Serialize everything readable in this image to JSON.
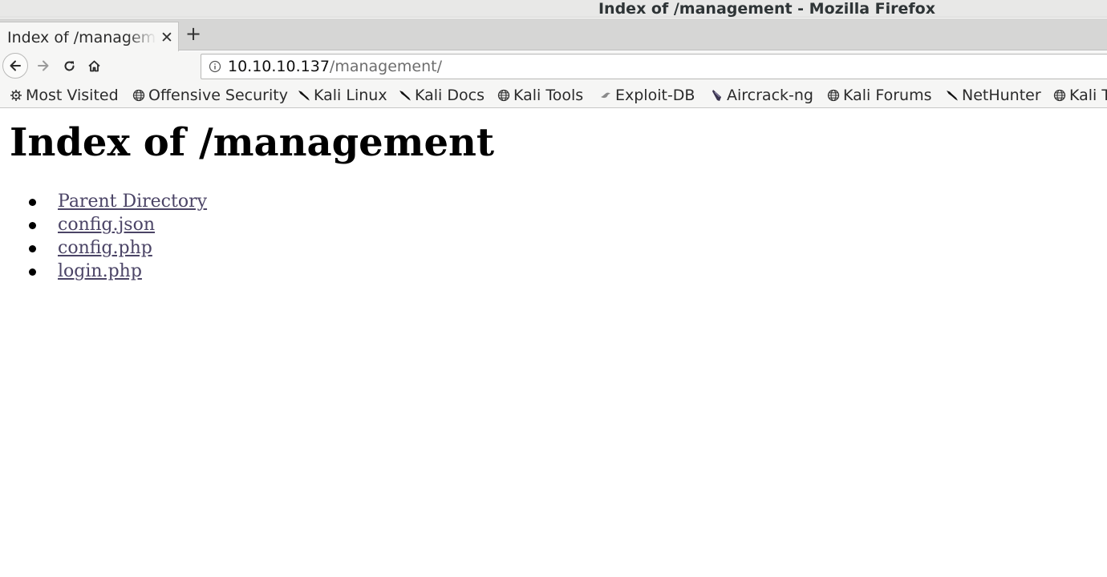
{
  "window": {
    "title": "Index of /management - Mozilla Firefox"
  },
  "tabs": [
    {
      "label": "Index of /management",
      "close_symbol": "✕"
    }
  ],
  "new_tab_symbol": "+",
  "urlbar": {
    "host": "10.10.10.137",
    "path": "/management/"
  },
  "bookmarks": [
    {
      "label": "Most Visited",
      "icon": "gear-icon"
    },
    {
      "label": "Offensive Security",
      "icon": "globe-icon"
    },
    {
      "label": "Kali Linux",
      "icon": "kali-dragon-icon"
    },
    {
      "label": "Kali Docs",
      "icon": "kali-dragon-icon"
    },
    {
      "label": "Kali Tools",
      "icon": "globe-icon"
    },
    {
      "label": "Exploit-DB",
      "icon": "exploit-db-icon"
    },
    {
      "label": "Aircrack-ng",
      "icon": "aircrack-icon"
    },
    {
      "label": "Kali Forums",
      "icon": "globe-icon"
    },
    {
      "label": "NetHunter",
      "icon": "kali-dragon-icon"
    },
    {
      "label": "Kali Training",
      "icon": "globe-icon"
    }
  ],
  "page": {
    "heading": "Index of /management",
    "entries": [
      {
        "label": "Parent Directory"
      },
      {
        "label": "config.json"
      },
      {
        "label": "config.php"
      },
      {
        "label": "login.php"
      }
    ]
  },
  "colors": {
    "link": "#4b4466",
    "chrome": "#f6f6f5",
    "tabstrip": "#d6d6d5"
  }
}
